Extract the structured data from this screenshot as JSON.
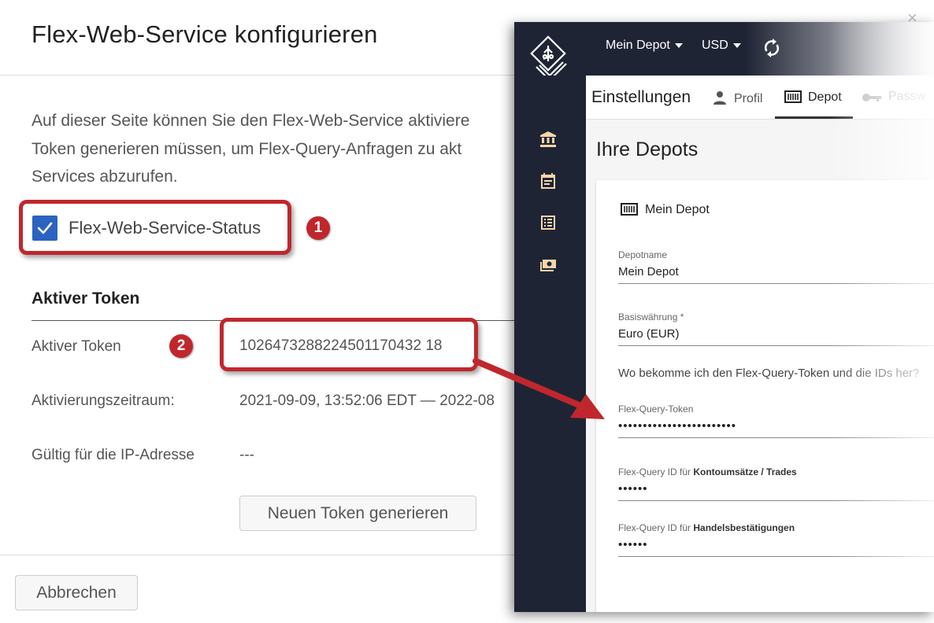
{
  "dialog": {
    "title": "Flex-Web-Service konfigurieren",
    "close_glyph": "×",
    "intro_lines": [
      "Auf dieser Seite können Sie den Flex-Web-Service aktiviere",
      "Token generieren müssen, um Flex-Query-Anfragen zu akt",
      "Services abzurufen."
    ],
    "status_label": "Flex-Web-Service-Status",
    "status_checked": true,
    "section_heading": "Aktiver Token",
    "rows": {
      "token_label": "Aktiver Token",
      "token_value": "1026473288224501170432 18",
      "period_label": "Aktivierungszeitraum:",
      "period_value": "2021-09-09, 13:52:06 EDT — 2022-08",
      "ip_label": "Gültig für die IP-Adresse",
      "ip_value": "---"
    },
    "generate_button": "Neuen Token generieren",
    "cancel_button": "Abbrechen"
  },
  "callouts": {
    "badge_1": "1",
    "badge_2": "2"
  },
  "app": {
    "appbar": {
      "depot_menu": "Mein Depot",
      "currency_menu": "USD"
    },
    "sidebar_icons": [
      "bank-icon",
      "calendar-icon",
      "list-icon",
      "money-icon"
    ],
    "tabs": {
      "title": "Einstellungen",
      "profil": "Profil",
      "depot": "Depot",
      "password": "Passw"
    },
    "page_heading": "Ihre Depots",
    "card": {
      "title": "Mein Depot",
      "depotname_label": "Depotname",
      "depotname_value": "Mein Depot",
      "currency_label": "Basiswährung *",
      "currency_value": "Euro (EUR)",
      "help_link": "Wo bekomme ich den Flex-Query-Token und die IDs her?",
      "token_label": "Flex-Query-Token",
      "token_value": "••••••••••••••••••••••••",
      "konto_label_prefix": "Flex-Query ID für ",
      "konto_label_bold": "Kontoumsätze / Trades",
      "konto_value": "••••••",
      "handel_label_prefix": "Flex-Query ID für ",
      "handel_label_bold": "Handelsbestätigungen",
      "handel_value": "••••••"
    }
  },
  "colors": {
    "highlight_red": "#c0272d",
    "checkbox_blue": "#2a63c0",
    "app_dark": "#1f2435",
    "icon_orange": "#f5d6a8"
  }
}
